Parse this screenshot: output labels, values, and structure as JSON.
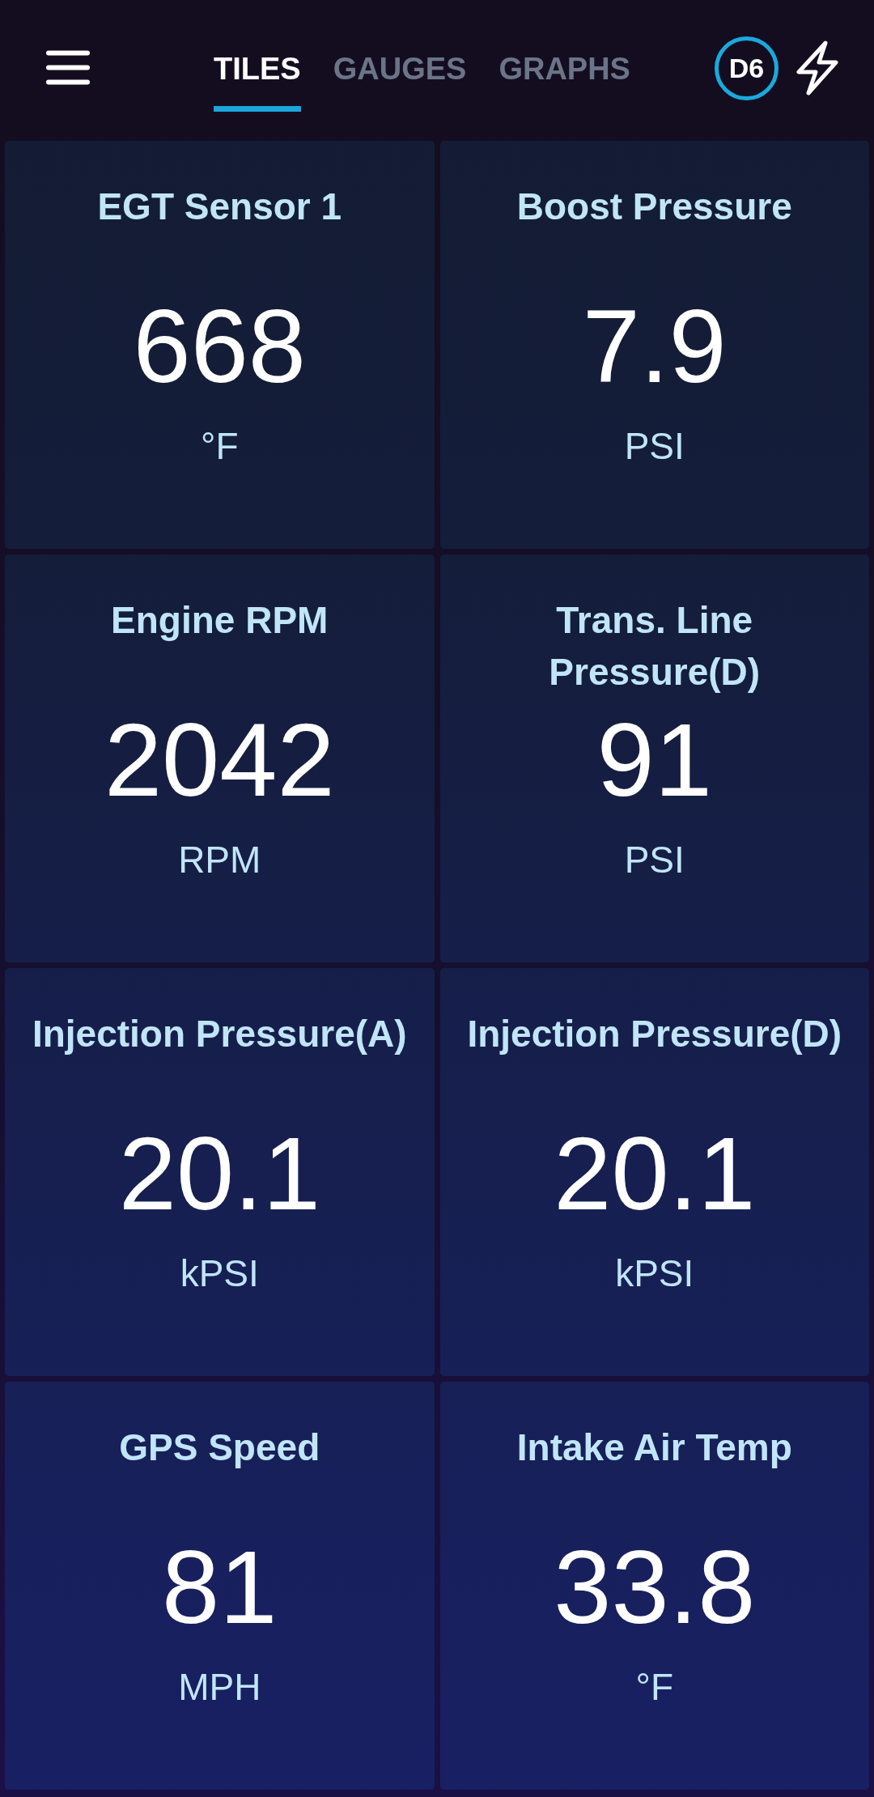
{
  "tabs": [
    {
      "label": "TILES",
      "selected": true
    },
    {
      "label": "GAUGES",
      "selected": false
    },
    {
      "label": "GRAPHS",
      "selected": false
    }
  ],
  "device_badge": "D6",
  "tiles": [
    {
      "title": "EGT Sensor 1",
      "value": "668",
      "unit": "°F"
    },
    {
      "title": "Boost Pressure",
      "value": "7.9",
      "unit": "PSI"
    },
    {
      "title": "Engine RPM",
      "value": "2042",
      "unit": "RPM"
    },
    {
      "title": "Trans. Line Pressure(D)",
      "value": "91",
      "unit": "PSI"
    },
    {
      "title": "Injection Pressure(A)",
      "value": "20.1",
      "unit": "kPSI"
    },
    {
      "title": "Injection Pressure(D)",
      "value": "20.1",
      "unit": "kPSI"
    },
    {
      "title": "GPS Speed",
      "value": "81",
      "unit": "MPH"
    },
    {
      "title": "Intake Air Temp",
      "value": "33.8",
      "unit": "°F"
    }
  ]
}
